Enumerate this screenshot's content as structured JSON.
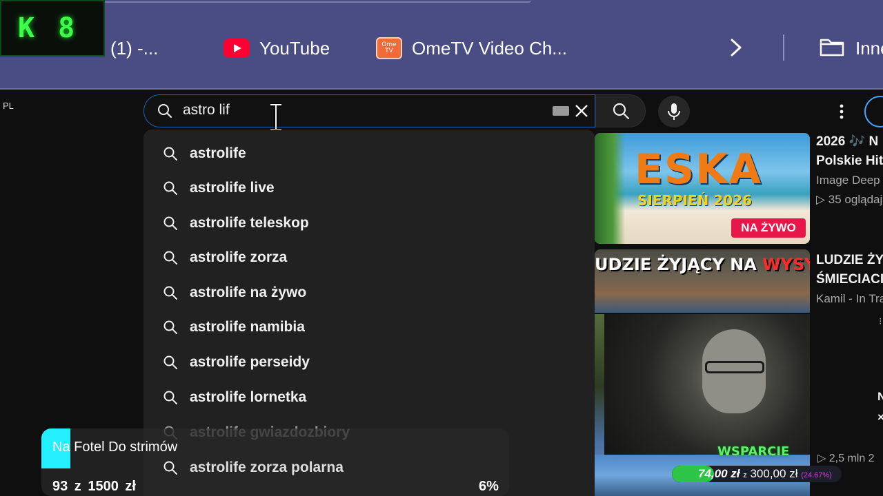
{
  "bookmarks_bar": {
    "items": [
      {
        "label": "(1) -...",
        "icon": "overlay-obscured"
      },
      {
        "label": "YouTube",
        "icon": "youtube-icon"
      },
      {
        "label": "OmeTV Video Ch...",
        "icon": "ometv-icon"
      }
    ],
    "overflow_label": "Inne",
    "ometv_logo_text": "Ome TV"
  },
  "overlay_badge": {
    "left": "K",
    "right": "8",
    "color": "#3cff4a"
  },
  "youtube": {
    "region_label": "PL",
    "search": {
      "query": "astro lif"
    },
    "suggestions": [
      "astrolife",
      "astrolife live",
      "astrolife teleskop",
      "astrolife zorza",
      "astrolife na żywo",
      "astrolife namibia",
      "astrolife perseidy",
      "astrolife lornetka",
      "astrolife gwiazdozbiory",
      "astrolife zorza polarna"
    ],
    "videos": [
      {
        "thumb_title": "ESKA",
        "thumb_subtitle": "SIERPIEŃ 2026",
        "live_badge": "NA ŻYWO",
        "title_line1": "2026 🎶 N",
        "title_line2": "Polskie Hit",
        "channel": "Image Deep",
        "meta": "▷ 35 oglądaj"
      },
      {
        "thumb_banner_a": "UDZIE ŻYJĄCY NA ",
        "thumb_banner_b": "WYSYPISKACH",
        "title_line1": "LUDZIE ŻY",
        "title_line2": "ŚMIECIACI",
        "channel": "Kamil - In Tra"
      }
    ],
    "partial_meta": "▷ 2,5 mln  2",
    "edge_letters": {
      "n": "N",
      "x": "×",
      "dot": "⁝"
    }
  },
  "donation_overlay": {
    "label": "WSPARCIE",
    "current": "74,00 zł",
    "separator": "z",
    "target": "300,00 zł",
    "percent": "(24.67%)",
    "progress": 0.2467,
    "accent": "#2ec447"
  },
  "goal_widget": {
    "title": "Na Fotel Do strimów",
    "amount_text": "93 z 1500 zł",
    "percent_text": "6%",
    "accent": "#22f0ff"
  }
}
